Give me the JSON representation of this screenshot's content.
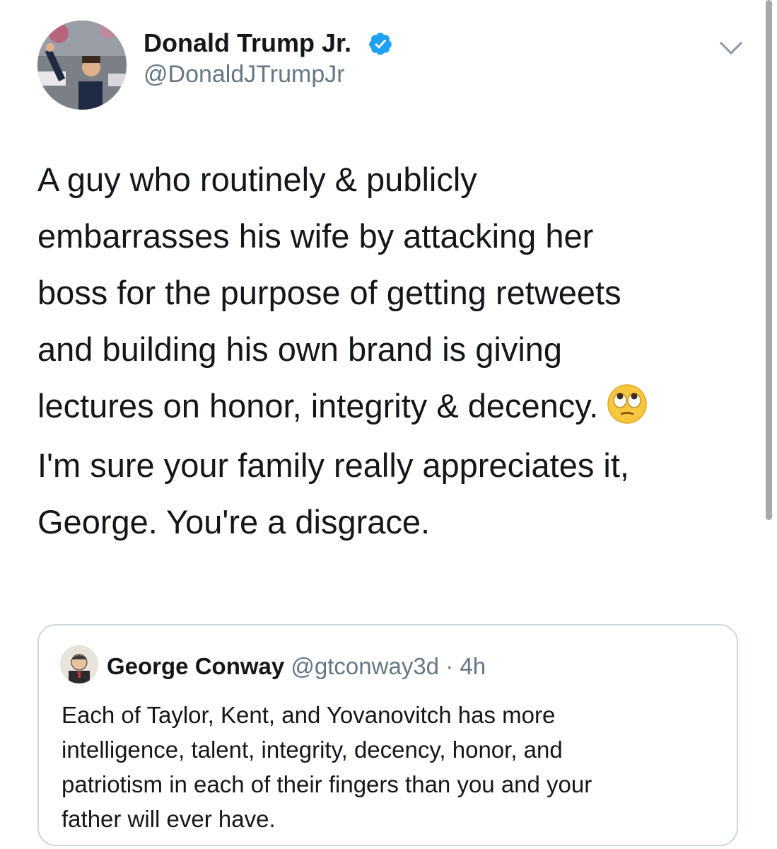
{
  "author": {
    "name": "Donald Trump Jr.",
    "handle": "@DonaldJTrumpJr",
    "verified_color": "#1DA1F2"
  },
  "tweet": {
    "paragraph1_lines": [
      "A guy who routinely & publicly",
      "embarrasses his wife by attacking her",
      "boss for the purpose of getting retweets",
      "and building his own brand is giving",
      "lectures on honor, integrity & decency."
    ],
    "emoji": "face-with-rolling-eyes",
    "paragraph2_lines": [
      "I'm sure your family really appreciates it,",
      "George. You're a disgrace."
    ]
  },
  "quoted_tweet": {
    "name": "George Conway",
    "handle": "@gtconway3d",
    "separator": "·",
    "time": "4h",
    "lines": [
      "Each of Taylor, Kent, and Yovanovitch has more",
      "intelligence, talent, integrity, decency, honor, and",
      "patriotism in each of their fingers than you and your",
      "father will ever have."
    ]
  },
  "icons": {
    "verified": "verified-badge-icon",
    "menu": "chevron-down-icon"
  }
}
